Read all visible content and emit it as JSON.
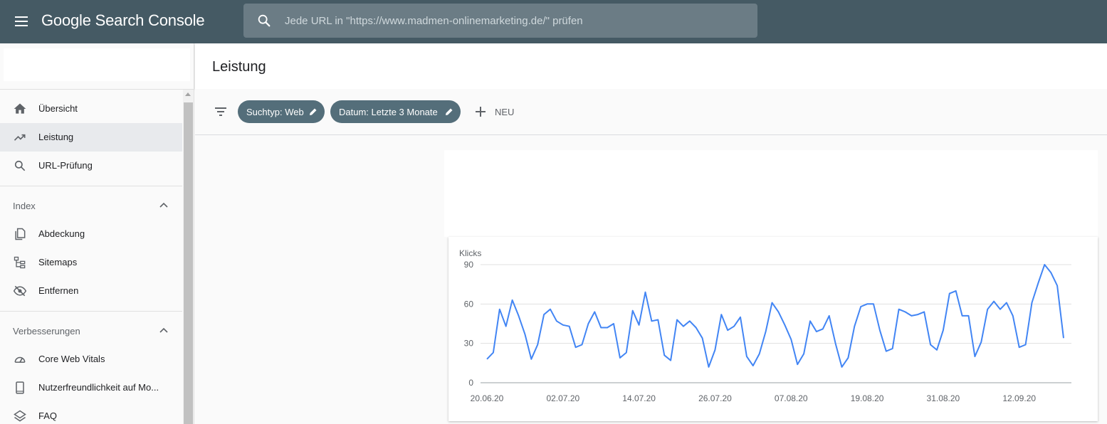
{
  "app": {
    "brand": "Google Search Console"
  },
  "search": {
    "placeholder": "Jede URL in \"https://www.madmen-onlinemarketing.de/\" prüfen"
  },
  "sidebar": {
    "items": [
      {
        "label": "Übersicht",
        "icon": "home-icon"
      },
      {
        "label": "Leistung",
        "icon": "trending-up-icon",
        "active": true
      },
      {
        "label": "URL-Prüfung",
        "icon": "search-icon"
      }
    ],
    "sections": [
      {
        "title": "Index",
        "items": [
          {
            "label": "Abdeckung",
            "icon": "copy-pages-icon"
          },
          {
            "label": "Sitemaps",
            "icon": "sitemap-icon"
          },
          {
            "label": "Entfernen",
            "icon": "eye-off-icon"
          }
        ]
      },
      {
        "title": "Verbesserungen",
        "items": [
          {
            "label": "Core Web Vitals",
            "icon": "gauge-icon"
          },
          {
            "label": "Nutzerfreundlichkeit auf Mo...",
            "icon": "smartphone-icon"
          },
          {
            "label": "FAQ",
            "icon": "layers-icon"
          }
        ]
      }
    ]
  },
  "page": {
    "title": "Leistung"
  },
  "filters": {
    "chips": [
      "Suchtyp: Web",
      "Datum: Letzte 3 Monate"
    ],
    "new_label": "NEU"
  },
  "colors": {
    "topbar": "#455a64",
    "chip": "#546e7a",
    "line": "#4285f4"
  },
  "chart_data": {
    "type": "line",
    "ylabel": "Klicks",
    "ylim": [
      0,
      90
    ],
    "yticks": [
      0,
      30,
      60,
      90
    ],
    "xticks": [
      "20.06.20",
      "02.07.20",
      "14.07.20",
      "26.07.20",
      "07.08.20",
      "19.08.20",
      "31.08.20",
      "12.09.20"
    ],
    "start_date": "20.06.20",
    "grid": true,
    "series": [
      {
        "values": [
          18,
          23,
          56,
          43,
          63,
          51,
          37,
          18,
          29,
          52,
          56,
          47,
          44,
          43,
          27,
          29,
          45,
          54,
          42,
          42,
          45,
          19,
          23,
          55,
          44,
          69,
          47,
          48,
          21,
          17,
          48,
          43,
          47,
          42,
          34,
          12,
          25,
          52,
          40,
          43,
          50,
          20,
          13,
          22,
          39,
          61,
          54,
          44,
          33,
          14,
          22,
          47,
          39,
          41,
          51,
          30,
          12,
          19,
          43,
          58,
          60,
          60,
          40,
          24,
          26,
          56,
          54,
          51,
          52,
          54,
          29,
          25,
          40,
          68,
          70,
          51,
          51,
          20,
          31,
          56,
          62,
          56,
          61,
          51,
          27,
          29,
          61,
          76,
          90,
          84,
          74,
          34
        ]
      }
    ]
  }
}
